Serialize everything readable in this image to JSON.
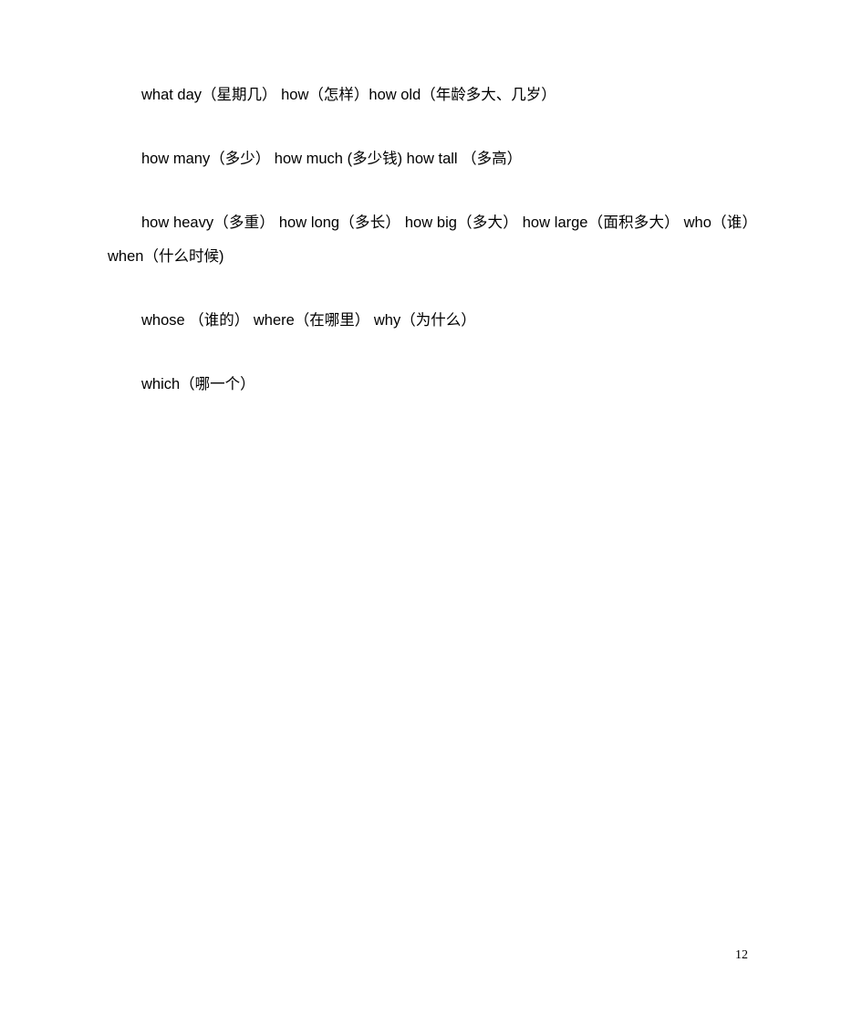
{
  "document": {
    "page_number": "12",
    "background_color": "#ffffff",
    "text_color": "#000000",
    "paragraphs": [
      {
        "id": "para-1",
        "text": "what day（星期几）  how（怎样）how old（年龄多大、几岁）",
        "entries": [
          {
            "term": "what day",
            "gloss": "星期几"
          },
          {
            "term": "how",
            "gloss": "怎样"
          },
          {
            "term": "how old",
            "gloss": "年龄多大、几岁"
          }
        ]
      },
      {
        "id": "para-2",
        "text": "how many（多少）   how much (多少钱)   how tall  （多高）",
        "entries": [
          {
            "term": "how many",
            "gloss": "多少"
          },
          {
            "term": "how much",
            "gloss": "多少钱"
          },
          {
            "term": "how tall",
            "gloss": "多高"
          }
        ]
      },
      {
        "id": "para-3",
        "text": "how heavy（多重）  how long（多长）   how big（多大）    how large（面积多大）  who（谁）    when（什么时候)",
        "entries": [
          {
            "term": "how heavy",
            "gloss": "多重"
          },
          {
            "term": "how long",
            "gloss": "多长"
          },
          {
            "term": "how big",
            "gloss": "多大"
          },
          {
            "term": "how large",
            "gloss": "面积多大"
          },
          {
            "term": "who",
            "gloss": "谁"
          },
          {
            "term": "when",
            "gloss": "什么时候"
          }
        ]
      },
      {
        "id": "para-4",
        "text": "whose  （谁的）    where（在哪里）  why（为什么）",
        "entries": [
          {
            "term": "whose",
            "gloss": "谁的"
          },
          {
            "term": "where",
            "gloss": "在哪里"
          },
          {
            "term": "why",
            "gloss": "为什么"
          }
        ]
      },
      {
        "id": "para-5",
        "text": "which（哪一个）",
        "entries": [
          {
            "term": "which",
            "gloss": "哪一个"
          }
        ]
      }
    ]
  }
}
